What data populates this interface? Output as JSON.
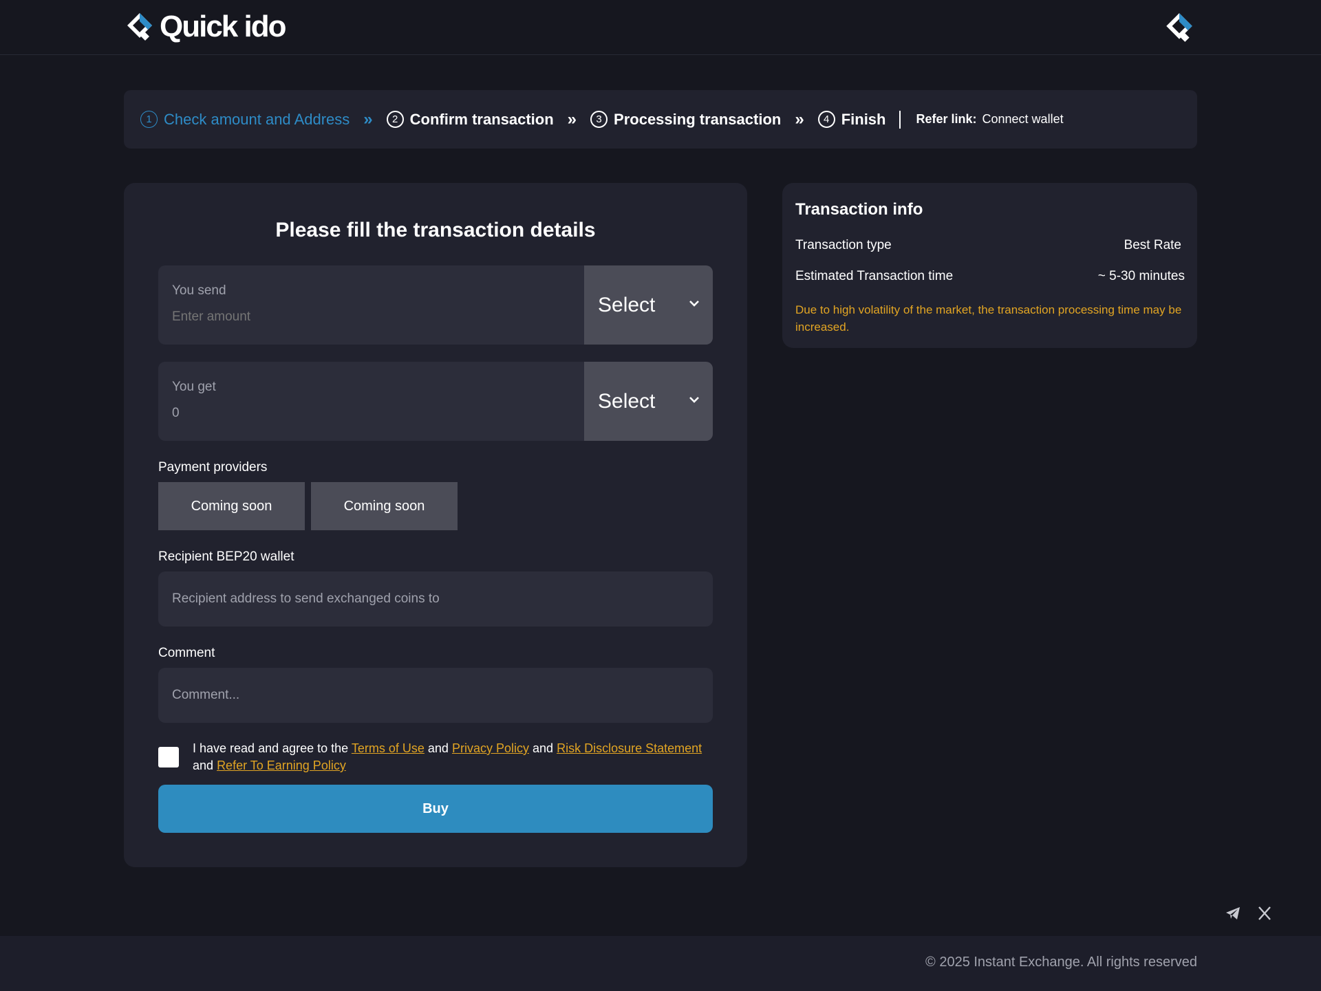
{
  "brand": {
    "name": "Quick ido",
    "accent": "#2e8cc7",
    "warning": "#e2a523"
  },
  "steps": [
    {
      "num": "1",
      "label": "Check amount and Address"
    },
    {
      "num": "2",
      "label": "Confirm transaction"
    },
    {
      "num": "3",
      "label": "Processing transaction"
    },
    {
      "num": "4",
      "label": "Finish"
    }
  ],
  "refer": {
    "label": "Refer link:",
    "value": "Connect wallet"
  },
  "form": {
    "title": "Please fill the transaction details",
    "send": {
      "label": "You send",
      "placeholder": "Enter amount",
      "select": "Select"
    },
    "get": {
      "label": "You get",
      "value": "0",
      "select": "Select"
    },
    "providers_label": "Payment providers",
    "providers": [
      "Coming soon",
      "Coming soon"
    ],
    "wallet_label": "Recipient BEP20 wallet",
    "wallet_placeholder": "Recipient address to send exchanged coins to",
    "comment_label": "Comment",
    "comment_placeholder": "Comment...",
    "agree": {
      "prefix": "I have read and agree to the",
      "terms": "Terms of Use",
      "and": "and",
      "privacy": "Privacy Policy",
      "risk": "Risk Disclosure Statement",
      "refer_policy": "Refer To Earning Policy"
    },
    "buy_label": "Buy"
  },
  "info": {
    "title": "Transaction info",
    "rows": [
      {
        "label": "Transaction type",
        "value": "Best Rate"
      },
      {
        "label": "Estimated Transaction time",
        "value": "~ 5-30 minutes"
      }
    ],
    "note": "Due to high volatility of the market, the transaction processing time may be increased."
  },
  "social": [
    "telegram-icon",
    "x-icon"
  ],
  "footer": {
    "copyright": "© 2025 Instant Exchange. All rights reserved"
  }
}
